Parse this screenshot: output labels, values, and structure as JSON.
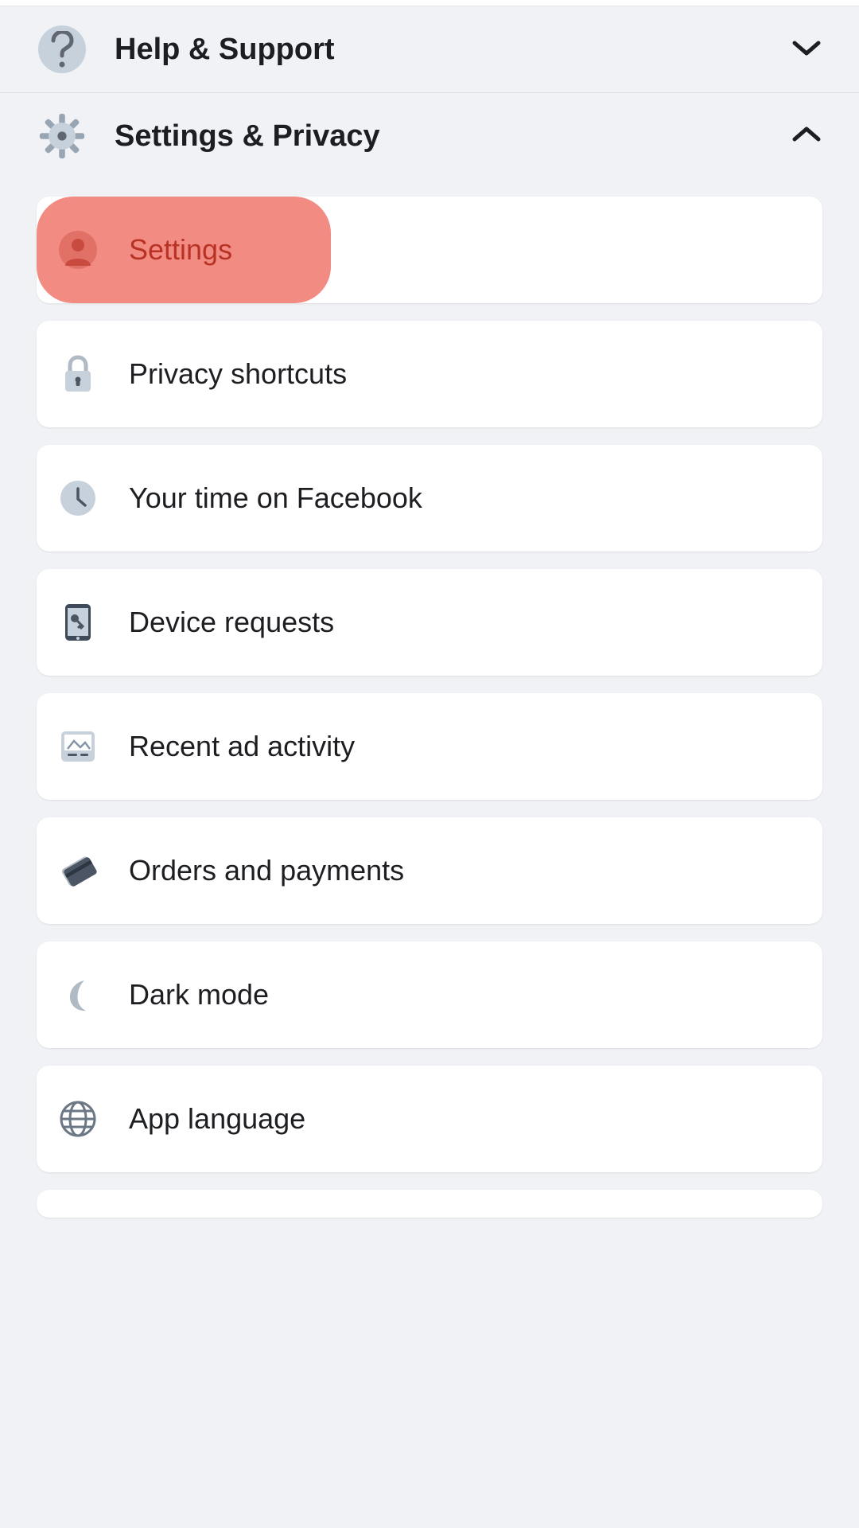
{
  "sections": {
    "help": {
      "title": "Help & Support",
      "expanded": false
    },
    "settings_privacy": {
      "title": "Settings & Privacy",
      "expanded": true,
      "items": [
        {
          "label": "Settings",
          "icon": "person-circle",
          "highlighted": true
        },
        {
          "label": "Privacy shortcuts",
          "icon": "lock",
          "highlighted": false
        },
        {
          "label": "Your time on Facebook",
          "icon": "clock",
          "highlighted": false
        },
        {
          "label": "Device requests",
          "icon": "phone-key",
          "highlighted": false
        },
        {
          "label": "Recent ad activity",
          "icon": "image",
          "highlighted": false
        },
        {
          "label": "Orders and payments",
          "icon": "credit-card",
          "highlighted": false
        },
        {
          "label": "Dark mode",
          "icon": "moon",
          "highlighted": false
        },
        {
          "label": "App language",
          "icon": "globe",
          "highlighted": false
        }
      ]
    }
  }
}
